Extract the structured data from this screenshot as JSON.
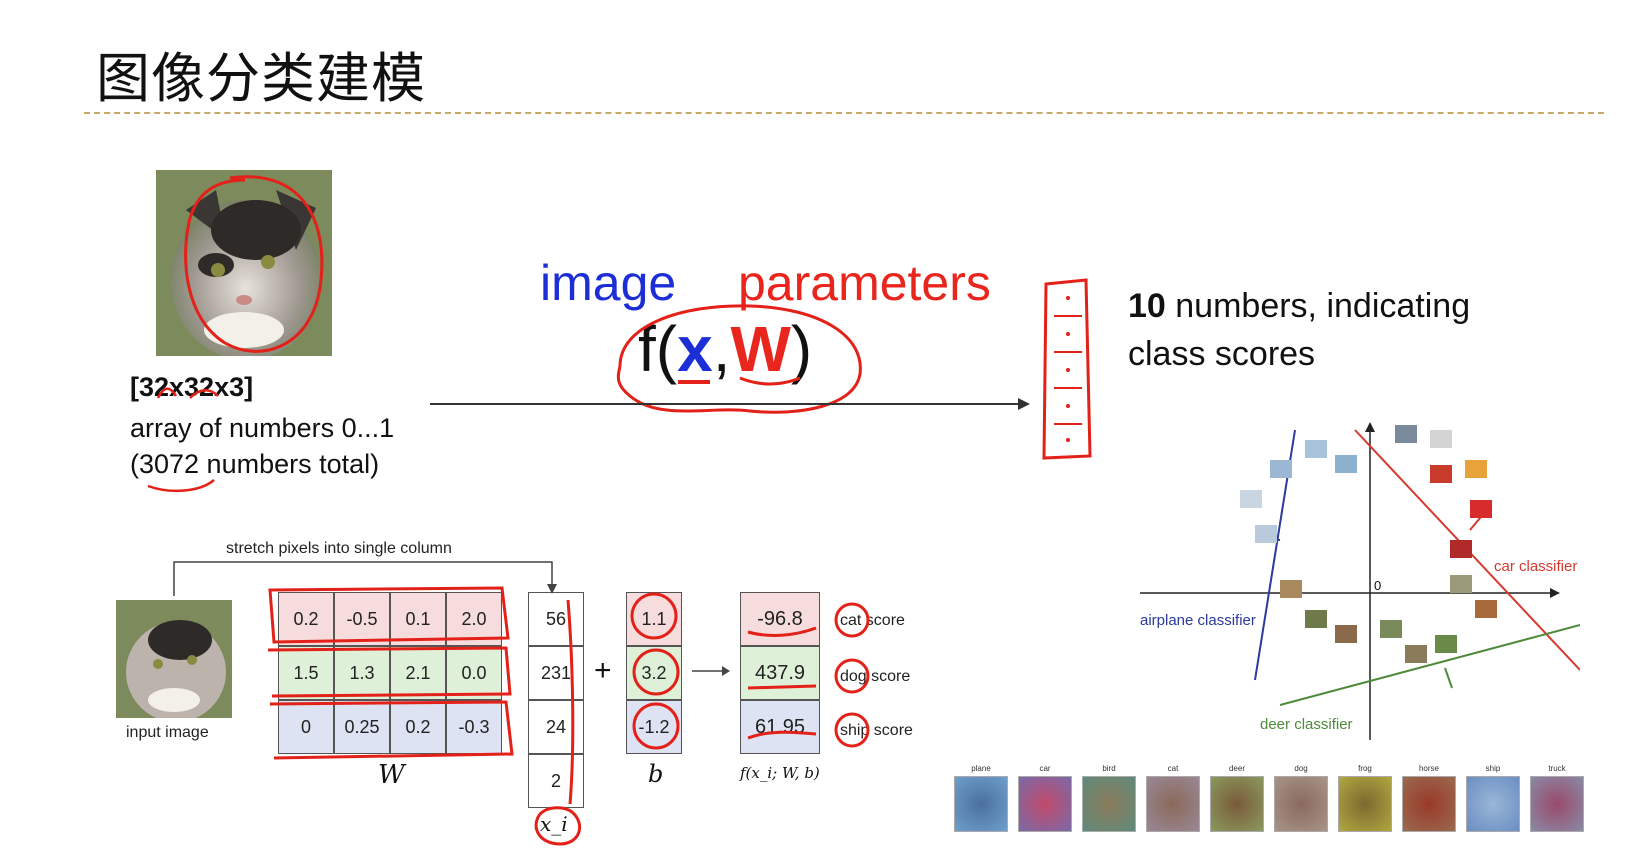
{
  "slide": {
    "title": "图像分类建模"
  },
  "input": {
    "dims": "[32x32x3]",
    "desc_line1": "array of numbers 0...1",
    "desc_line2": "(3072 numbers total)"
  },
  "function": {
    "image_label": "image",
    "parameters_label": "parameters",
    "f_open": "f(",
    "x": "x",
    "comma": ",",
    "w": "W",
    "close": ")"
  },
  "output": {
    "bold_number": "10",
    "text_line1": " numbers, indicating",
    "text_line2": "class scores"
  },
  "linear_example": {
    "stretch_label": "stretch pixels into single column",
    "input_label": "input image",
    "W_rows": [
      [
        "0.2",
        "-0.5",
        "0.1",
        "2.0"
      ],
      [
        "1.5",
        "1.3",
        "2.1",
        "0.0"
      ],
      [
        "0",
        "0.25",
        "0.2",
        "-0.3"
      ]
    ],
    "W_label": "W",
    "x_values": [
      "56",
      "231",
      "24",
      "2"
    ],
    "x_label": "x_i",
    "plus": "+",
    "b_values": [
      "1.1",
      "3.2",
      "-1.2"
    ],
    "b_label": "b",
    "scores": [
      "-96.8",
      "437.9",
      "61.95"
    ],
    "scores_label": "f(x_i; W, b)",
    "score_names": [
      "cat score",
      "dog score",
      "ship score"
    ],
    "row_colors": [
      "#f6dcdc",
      "#dff0d8",
      "#dde3f2"
    ]
  },
  "classifier_plot": {
    "origin_label": "0",
    "car_label": "car classifier",
    "airplane_label": "airplane classifier",
    "deer_label": "deer classifier",
    "colors": {
      "car": "#d6392e",
      "airplane": "#2b3a9c",
      "deer": "#4e8a3a"
    }
  },
  "templates": {
    "labels": [
      "plane",
      "car",
      "bird",
      "cat",
      "deer",
      "dog",
      "frog",
      "horse",
      "ship",
      "truck"
    ],
    "colors": [
      "#6f9fcb",
      "#7a6aa8",
      "#5e8a7a",
      "#9a8896",
      "#8a9a5e",
      "#a89488",
      "#b2a640",
      "#9a6a4e",
      "#6a8ec4",
      "#8a8aa8"
    ]
  }
}
